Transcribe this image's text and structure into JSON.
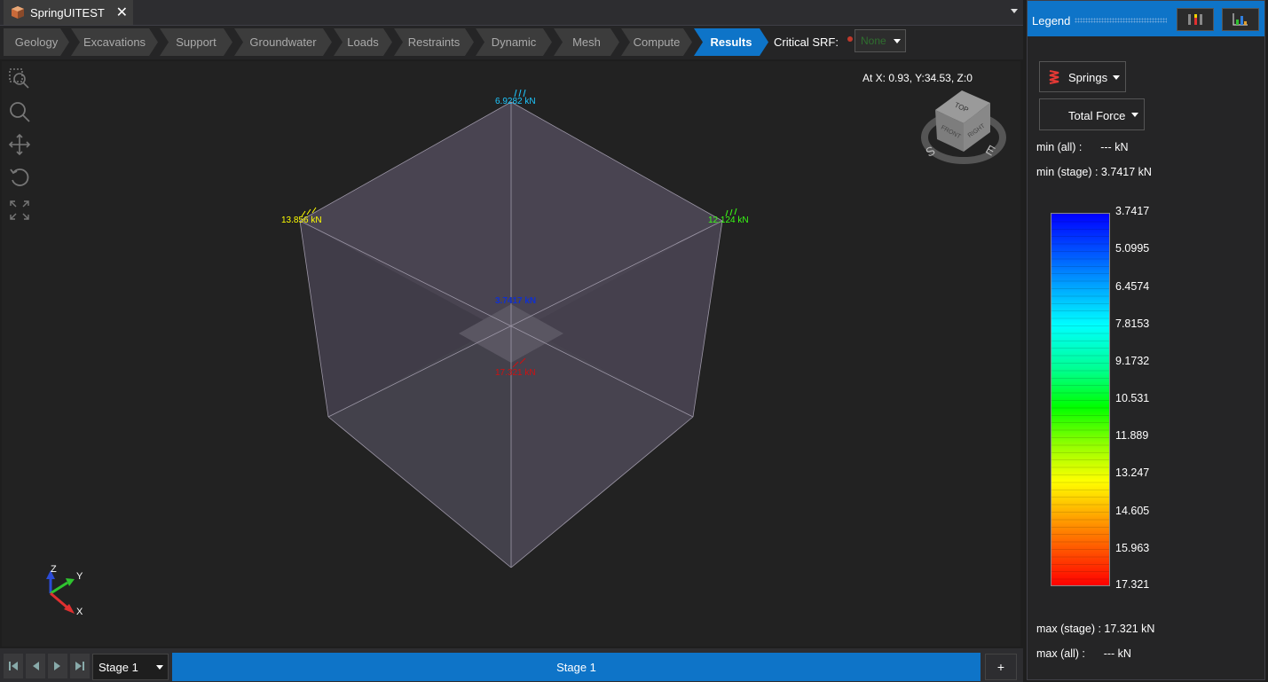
{
  "document_tab": {
    "title": "SpringUITEST",
    "close_glyph": "✕"
  },
  "workflow": {
    "steps": [
      "Geology",
      "Excavations",
      "Support",
      "Groundwater",
      "Loads",
      "Restraints",
      "Dynamic",
      "Mesh",
      "Compute",
      "Results"
    ],
    "active_step": "Results",
    "critical_srf_label": "Critical SRF:",
    "critical_srf_value": "None"
  },
  "viewport": {
    "coords": "At X: 0.93, Y:34.53, Z:0",
    "tools": [
      "zoom-window-icon",
      "zoom-icon",
      "pan-icon",
      "rotate-icon",
      "zoom-extents-icon"
    ],
    "labels": {
      "top": "6.9282 kN",
      "left": "13.856 kN",
      "right": "12.124 kN",
      "center": "3.7417 kN",
      "bottom_center": "17.321 kN"
    },
    "label_colors": {
      "top": "#1ec8ff",
      "left": "#ffff00",
      "right": "#39ff14",
      "center": "#1030d0",
      "bottom_center": "#d01010"
    },
    "view_cube": {
      "top": "TOP",
      "front": "FRONT",
      "right": "RIGHT",
      "south": "S",
      "east": "E"
    },
    "axes": {
      "z": "Z",
      "y": "Y",
      "x": "X"
    }
  },
  "stagebar": {
    "stage_select": "Stage 1",
    "stage_tab": "Stage 1",
    "add_label": "+"
  },
  "legend": {
    "title": "Legend",
    "springs_label": "Springs",
    "force_label": "Total Force",
    "min_all": "min (all) :      --- kN",
    "min_stage": "min (stage) : 3.7417 kN",
    "max_stage": "max (stage) : 17.321 kN",
    "max_all": "max (all) :      --- kN",
    "ticks": [
      "3.7417",
      "5.0995",
      "6.4574",
      "7.8153",
      "9.1732",
      "10.531",
      "11.889",
      "13.247",
      "14.605",
      "15.963",
      "17.321"
    ]
  },
  "colors": {
    "accent": "#0e74c8",
    "panel": "#252526",
    "background": "#222222"
  }
}
